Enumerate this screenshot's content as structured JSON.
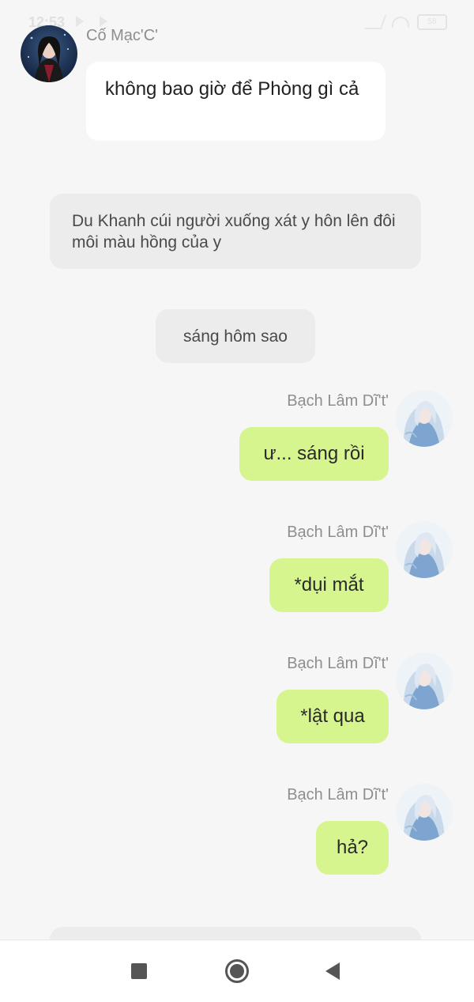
{
  "status_bar": {
    "time": "12:53",
    "battery": "58"
  },
  "messages": [
    {
      "sender": "Cố Mạc'C'",
      "text": "không bao giờ để Phòng gì cả",
      "side": "left",
      "avatar": "dark-haired-man-avatar"
    },
    {
      "type": "narration",
      "text": "Du Khanh cúi người xuống xát y hôn lên đôi môi màu hồng của y"
    },
    {
      "type": "narration",
      "text": "sáng hôm sao"
    },
    {
      "sender": "Bạch Lâm Dĩ't'",
      "text": "ư... sáng rồi",
      "side": "right",
      "avatar": "white-haired-avatar"
    },
    {
      "sender": "Bạch Lâm Dĩ't'",
      "text": "*dụi mắt",
      "side": "right",
      "avatar": "white-haired-avatar"
    },
    {
      "sender": "Bạch Lâm Dĩ't'",
      "text": "*lật qua",
      "side": "right",
      "avatar": "white-haired-avatar"
    },
    {
      "sender": "Bạch Lâm Dĩ't'",
      "text": "hả?",
      "side": "right",
      "avatar": "white-haired-avatar"
    }
  ],
  "nav_bar": {
    "recents_icon": "square-icon",
    "home_icon": "circle-icon",
    "back_icon": "triangle-back-icon"
  },
  "colors": {
    "background": "#f6f6f6",
    "user_bubble": "#d6f58f",
    "other_bubble": "#ffffff",
    "narration_bubble": "#ececec"
  }
}
